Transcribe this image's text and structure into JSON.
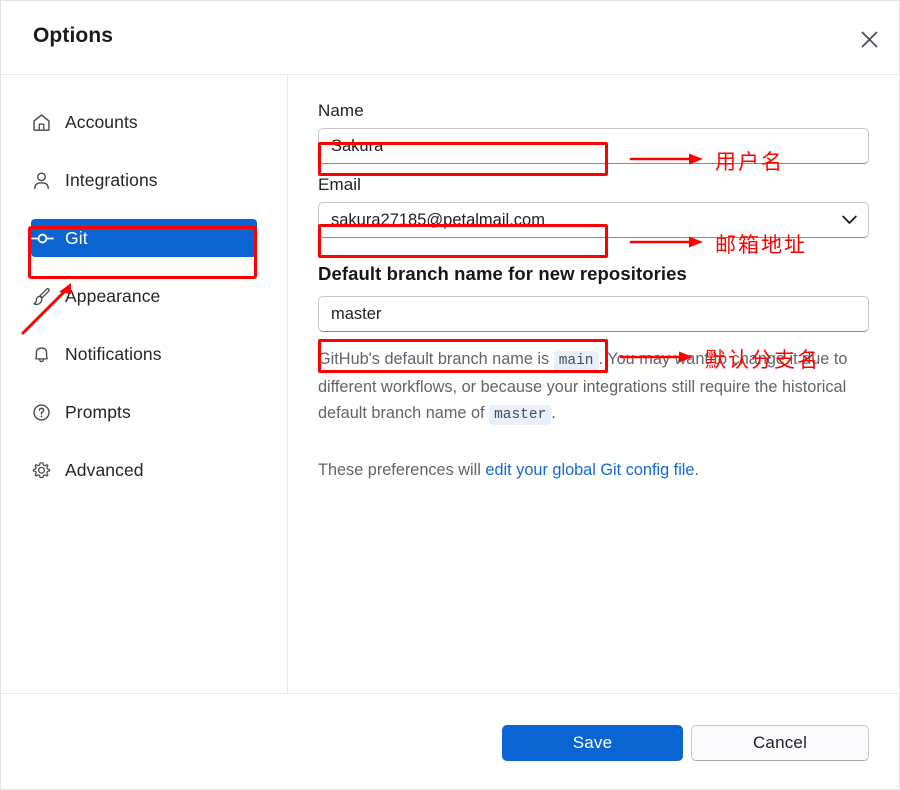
{
  "window": {
    "title": "Options",
    "close_icon": "close-icon"
  },
  "sidebar": {
    "items": [
      {
        "label": "Accounts",
        "icon": "home-icon",
        "selected": false
      },
      {
        "label": "Integrations",
        "icon": "person-icon",
        "selected": false
      },
      {
        "label": "Git",
        "icon": "git-commit-icon",
        "selected": true
      },
      {
        "label": "Appearance",
        "icon": "paintbrush-icon",
        "selected": false
      },
      {
        "label": "Notifications",
        "icon": "bell-icon",
        "selected": false
      },
      {
        "label": "Prompts",
        "icon": "question-circle-icon",
        "selected": false
      },
      {
        "label": "Advanced",
        "icon": "gear-icon",
        "selected": false
      }
    ]
  },
  "main": {
    "name_label": "Name",
    "name_value": "Sakura",
    "email_label": "Email",
    "email_value": "sakura27185@petalmail.com",
    "email_chevron_icon": "chevron-down-icon",
    "branch_heading": "Default branch name for new repositories",
    "branch_value": "master",
    "description": {
      "part1": "GitHub's default branch name is ",
      "code1": "main",
      "part2": ". You may want to change it due to different workflows, or because your integrations still require the historical default branch name of ",
      "code2": "master",
      "part3": "."
    },
    "preferences": {
      "prefix": "These preferences will ",
      "link": "edit your global Git config file",
      "suffix": "."
    }
  },
  "footer": {
    "save_label": "Save",
    "cancel_label": "Cancel"
  },
  "annotations": {
    "accent_color": "#ff0000",
    "name_note": "用户名",
    "email_note": "邮箱地址",
    "branch_note": "默认分支名"
  },
  "colors": {
    "selected_nav_bg": "#0a64d2",
    "primary_button": "#0a64d2",
    "link": "#1368d4",
    "code_chip_bg": "#e8f0fb",
    "annotation_red": "#ff0000"
  }
}
